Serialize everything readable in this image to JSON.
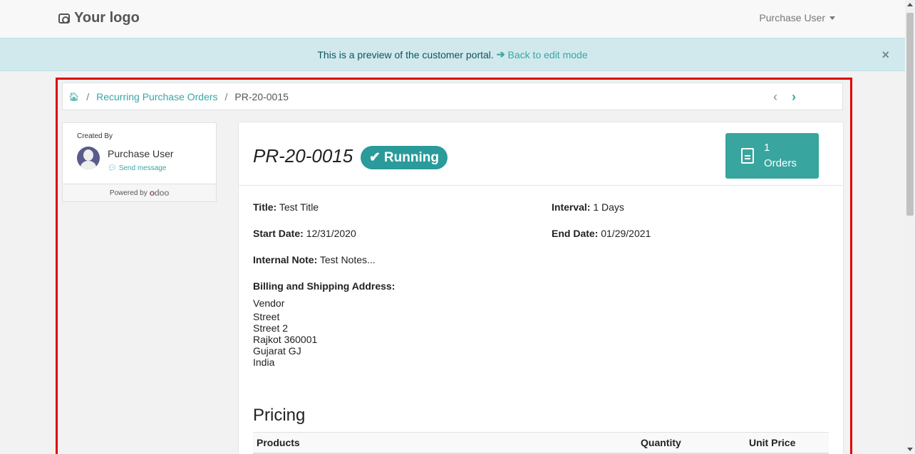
{
  "navbar": {
    "logo_text": "Your logo",
    "user_menu_label": "Purchase User"
  },
  "banner": {
    "message": "This is a preview of the customer portal.",
    "link_label": "Back to edit mode",
    "close_glyph": "×"
  },
  "breadcrumb": {
    "items": [
      "Recurring Purchase Orders",
      "PR-20-0015"
    ]
  },
  "sidebar": {
    "created_by_label": "Created By",
    "user_name": "Purchase User",
    "send_message_label": "Send message",
    "powered_by_label": "Powered by"
  },
  "document": {
    "title": "PR-20-0015",
    "status": "Running",
    "orders_count": "1",
    "orders_label": "Orders",
    "fields": {
      "title_label": "Title:",
      "title_value": "Test Title",
      "interval_label": "Interval:",
      "interval_value": "1 Days",
      "start_label": "Start Date:",
      "start_value": "12/31/2020",
      "end_label": "End Date:",
      "end_value": "01/29/2021",
      "note_label": "Internal Note:",
      "note_value": "Test Notes...",
      "address_label": "Billing and Shipping Address:"
    },
    "address_lines": [
      "Vendor",
      "Street",
      "Street 2",
      "Rajkot 360001",
      "Gujarat GJ",
      "India"
    ],
    "pricing_title": "Pricing",
    "table_headers": [
      "Products",
      "Quantity",
      "Unit Price"
    ]
  },
  "colors": {
    "accent": "#3aa6a2",
    "banner_bg": "#d1e9ed",
    "highlight_frame": "#e00000"
  }
}
